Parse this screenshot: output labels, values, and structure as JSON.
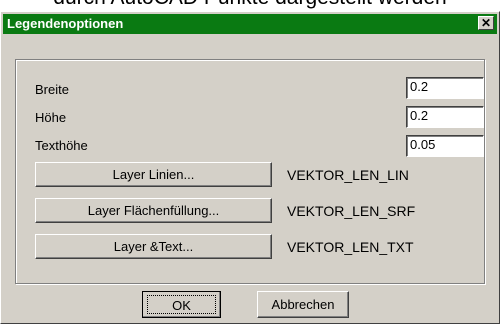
{
  "background_text": "durch AutoCAD Punkte dargestellt werden",
  "window": {
    "title": "Legendenoptionen",
    "close_glyph": "✕",
    "titlebar_color": "#0a7a12"
  },
  "fields": [
    {
      "label": "Breite",
      "value": "0.2"
    },
    {
      "label": "Höhe",
      "value": "0.2"
    },
    {
      "label": "Texthöhe",
      "value": "0.05"
    }
  ],
  "layers": [
    {
      "button": "Layer Linien...",
      "value": "VEKTOR_LEN_LIN"
    },
    {
      "button": "Layer Flächenfüllung...",
      "value": "VEKTOR_LEN_SRF"
    },
    {
      "button": "Layer &Text...",
      "value": "VEKTOR_LEN_TXT"
    }
  ],
  "buttons": {
    "ok": "OK",
    "cancel": "Abbrechen"
  }
}
